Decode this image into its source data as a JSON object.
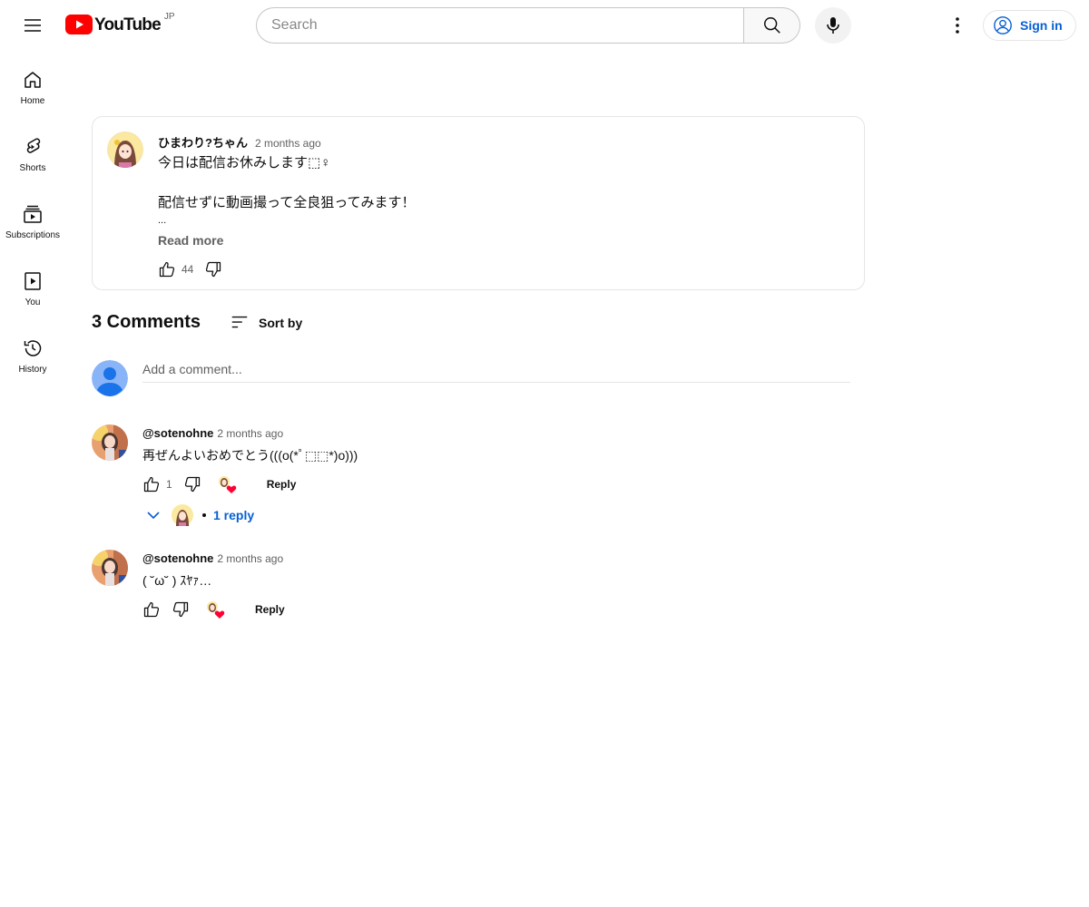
{
  "header": {
    "logo_text": "YouTube",
    "region": "JP",
    "search_placeholder": "Search",
    "sign_in_label": "Sign in"
  },
  "sidebar": {
    "items": [
      {
        "label": "Home",
        "icon": "home-icon"
      },
      {
        "label": "Shorts",
        "icon": "shorts-icon"
      },
      {
        "label": "Subscriptions",
        "icon": "subscriptions-icon"
      },
      {
        "label": "You",
        "icon": "you-icon"
      },
      {
        "label": "History",
        "icon": "history-icon"
      }
    ]
  },
  "post": {
    "author": "ひまわり?ちゃん",
    "time": "2 months ago",
    "line1": "今日は配信お休みします⬚♀",
    "line2": "配信せずに動画撮って全良狙ってみます！",
    "ellipsis": "...",
    "read_more": "Read more",
    "like_count": "44"
  },
  "comments_section": {
    "count_label": "3 Comments",
    "sort_label": "Sort by",
    "add_placeholder": "Add a comment...",
    "comments": [
      {
        "author": "@sotenohne",
        "time": "2 months ago",
        "text": "再ぜんよいおめでとう(((o(*ﾟ⬚⬚*)o)))",
        "like_count": "1",
        "reply_label": "Reply",
        "replies_label": "1 reply"
      },
      {
        "author": "@sotenohne",
        "time": "2 months ago",
        "text": "( ˘ω˘ ) ｽﾔｧ…",
        "like_count": "",
        "reply_label": "Reply"
      }
    ]
  },
  "colors": {
    "brand_red": "#ff0000",
    "link_blue": "#065fd4",
    "heart_red": "#ff0033",
    "avatar_blue": "#8ab4f8"
  }
}
